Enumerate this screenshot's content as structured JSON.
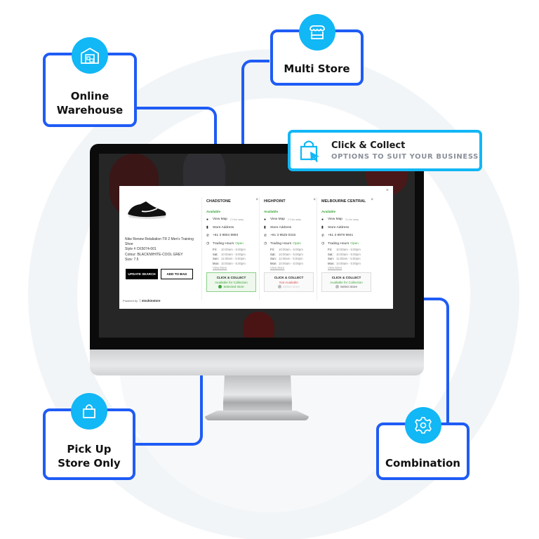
{
  "colors": {
    "connector": "#1f5cf5",
    "icon_circle": "#12b7f5",
    "available_green": "#3aa63a",
    "not_available_red": "#d9534f"
  },
  "features": {
    "online_warehouse": {
      "label_line1": "Online",
      "label_line2": "Warehouse",
      "icon": "warehouse-icon"
    },
    "multi_store": {
      "label": "Multi Store",
      "icon": "storefront-icon"
    },
    "pick_up": {
      "label_line1": "Pick Up",
      "label_line2": "Store Only",
      "icon": "shopping-bag-icon"
    },
    "combination": {
      "label": "Combination",
      "icon": "gear-icon"
    }
  },
  "callout": {
    "title": "Click & Collect",
    "subtitle": "OPTIONS TO SUIT YOUR BUSINESS",
    "icon": "bag-cursor-icon"
  },
  "modal": {
    "close": "×",
    "product": {
      "name": "Nike Renew Retaliation TR 2 Men's Training Shoe",
      "style": "Style # CK5074-001",
      "colour": "Colour: BLACK/WHITE-COOL GREY",
      "size": "Size: 7.5"
    },
    "buttons": {
      "update_search": "UPDATE SEARCH",
      "add_to_bag": "ADD TO BAG"
    },
    "powered_by": "Powered by",
    "brand": "stockinstore",
    "stores": [
      {
        "name": "CHADSTONE",
        "close": "×",
        "availability": "Available",
        "view_map": "View Map",
        "distance": "2.0 km away",
        "address": "Store Address",
        "phone": "+61 3 9804 8993",
        "trading_hours_label": "Trading Hours",
        "open_status": "Open",
        "hours": [
          {
            "day": "Fri:",
            "time": "10:00am - 5:00pm"
          },
          {
            "day": "Sat:",
            "time": "10:00am - 5:00pm"
          },
          {
            "day": "Sun:",
            "time": "11:00am - 5:00pm"
          },
          {
            "day": "Mon:",
            "time": "10:00am - 5:00pm"
          }
        ],
        "view_more": "View More",
        "cc_title": "CLICK & COLLECT",
        "cc_status": "Available for Collection",
        "cc_select": "Selected store",
        "selected": true
      },
      {
        "name": "HIGHPOINT",
        "close": "×",
        "availability": "Available",
        "view_map": "View Map",
        "distance": "2.0 km away",
        "address": "Store Address",
        "phone": "+61 3 9525 0316",
        "trading_hours_label": "Trading Hours",
        "open_status": "Open",
        "hours": [
          {
            "day": "Fri:",
            "time": "10:00am - 5:00pm"
          },
          {
            "day": "Sat:",
            "time": "10:00am - 5:00pm"
          },
          {
            "day": "Sun:",
            "time": "11:00am - 5:00pm"
          },
          {
            "day": "Mon:",
            "time": "10:00am - 5:00pm"
          }
        ],
        "view_more": "View More",
        "cc_title": "CLICK & COLLECT",
        "cc_status": "Not Available",
        "cc_select": "Select store",
        "selected": false
      },
      {
        "name": "MELBOURNE CENTRAL",
        "close": "×",
        "availability": "Available",
        "view_map": "View Map",
        "distance": "3.1 km away",
        "address": "Store Address",
        "phone": "+61 3 9978 9941",
        "trading_hours_label": "Trading Hours",
        "open_status": "Open",
        "hours": [
          {
            "day": "Fri:",
            "time": "10:00am - 6:00pm"
          },
          {
            "day": "Sat:",
            "time": "10:00am - 5:00pm"
          },
          {
            "day": "Sun:",
            "time": "11:00am - 5:00pm"
          },
          {
            "day": "Mon:",
            "time": "10:00am - 5:00pm"
          }
        ],
        "view_more": "View More",
        "cc_title": "CLICK & COLLECT",
        "cc_status": "Available for Collection",
        "cc_select": "Select store",
        "selected": false
      }
    ]
  }
}
